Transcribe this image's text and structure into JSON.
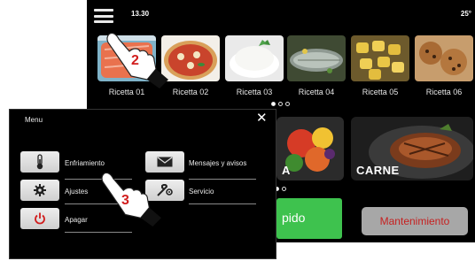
{
  "screen": {
    "time": "13.30",
    "temperature": "25°",
    "recipes": [
      {
        "label": "Ricetta 01"
      },
      {
        "label": "Ricetta 02"
      },
      {
        "label": "Ricetta 03"
      },
      {
        "label": "Ricetta 04"
      },
      {
        "label": "Ricetta 05"
      },
      {
        "label": "Ricetta 06"
      }
    ],
    "categories": [
      {
        "label": "A"
      },
      {
        "label": "CARNE"
      }
    ],
    "rapido_label": "pido",
    "mantenimiento_label": "Mantenimiento"
  },
  "menu": {
    "title": "Menu",
    "close_symbol": "✕",
    "items": [
      {
        "label": "Enfriamiento",
        "icon": "thermometer-icon"
      },
      {
        "label": "Mensajes y avisos",
        "icon": "envelope-icon"
      },
      {
        "label": "Ajustes",
        "icon": "gear-icon"
      },
      {
        "label": "Servicio",
        "icon": "wrench-icon"
      },
      {
        "label": "Apagar",
        "icon": "power-icon"
      }
    ]
  },
  "annotations": {
    "step_2": "2",
    "step_3": "3"
  },
  "colors": {
    "accent_red": "#d11d1d",
    "rapido_green": "#3ec24e",
    "mantenimiento_gray": "#a7a7a7"
  }
}
